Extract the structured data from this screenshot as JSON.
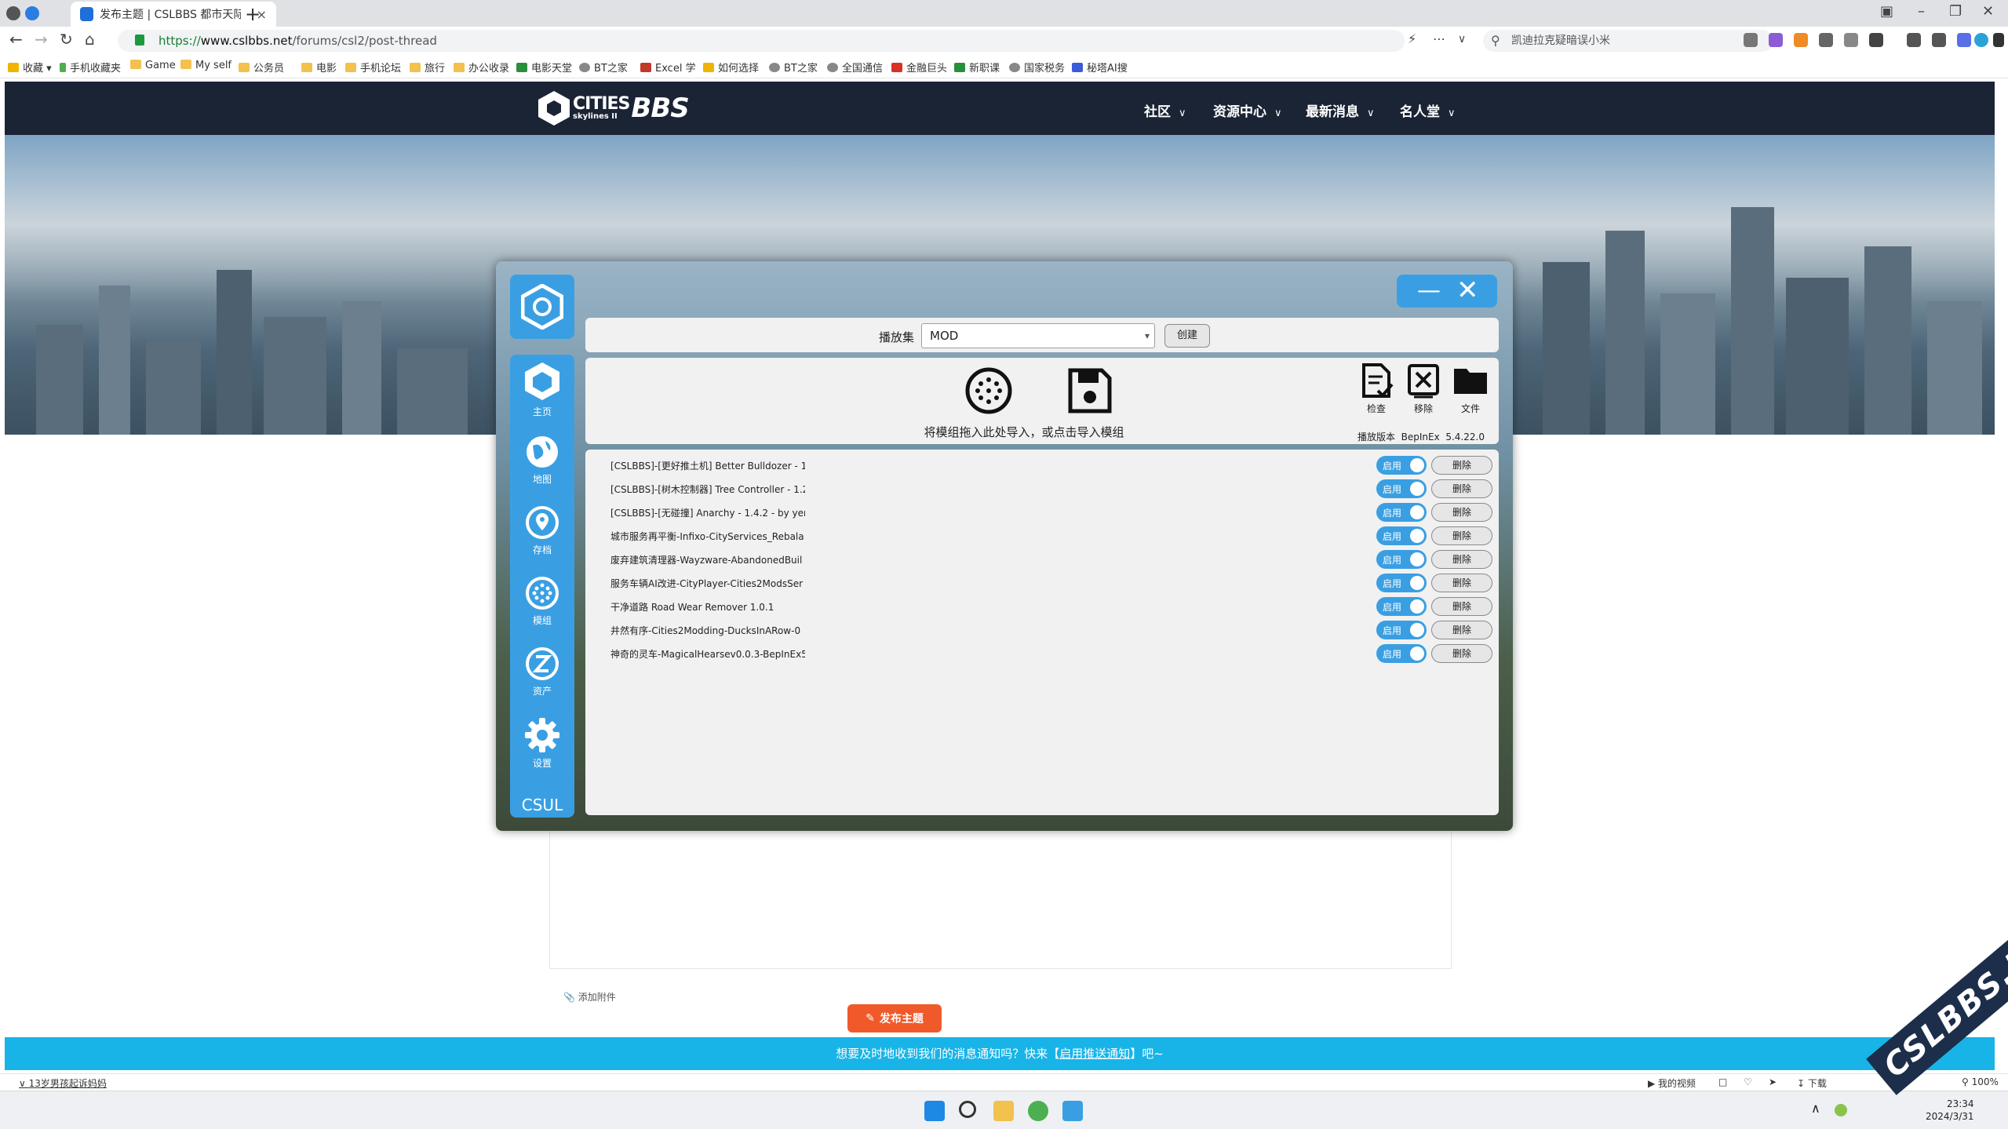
{
  "browser": {
    "active_tab_title": "发布主题 | CSLBBS 都市天际",
    "tab_close": "×",
    "new_tab": "+",
    "url_scheme": "https://",
    "url_host": "www.cslbbs.net",
    "url_path": "/forums/csl2/post-thread",
    "search_placeholder": "凯迪拉克疑暗误小米",
    "bookmarks": [
      "收藏",
      "手机收藏夹",
      "Game",
      "My self",
      "公务员",
      "电影",
      "手机论坛",
      "旅行",
      "办公收录",
      "电影天堂",
      "BT之家",
      "Excel 学",
      "如何选择",
      "BT之家",
      "全国通信",
      "金融巨头",
      "新职课",
      "国家税务",
      "秘塔AI搜"
    ]
  },
  "site": {
    "logo_line1": "CITIES",
    "logo_line2": "skylines II",
    "logo_bbs": "BBS",
    "nav": [
      "社区",
      "资源中心",
      "最新消息",
      "名人堂"
    ],
    "attach_label": "添加附件",
    "post_button": "发布主题",
    "notify_prefix": "想要及时地收到我们的消息通知吗？快来【",
    "notify_link": "启用推送通知",
    "notify_suffix": "】吧~",
    "watermark": "CSLBBS.NET"
  },
  "app": {
    "sidebar": [
      {
        "label": "主页",
        "icon": "home-hexagon-icon"
      },
      {
        "label": "地图",
        "icon": "globe-icon"
      },
      {
        "label": "存档",
        "icon": "location-pin-icon"
      },
      {
        "label": "模组",
        "icon": "dotted-circle-icon"
      },
      {
        "label": "资产",
        "icon": "z-circle-icon"
      },
      {
        "label": "设置",
        "icon": "gear-icon"
      }
    ],
    "brand": "CSUL",
    "playset_label": "播放集",
    "playset_value": "MOD",
    "create_button": "创建",
    "import_hint": "将模组拖入此处导入，或点击导入模组",
    "tools": [
      {
        "label": "检查",
        "icon": "check-file-icon"
      },
      {
        "label": "移除",
        "icon": "remove-box-icon"
      },
      {
        "label": "文件",
        "icon": "folder-icon"
      }
    ],
    "bepinex_label": "播放版本",
    "bepinex_name": "BepInEx",
    "bepinex_version": "5.4.22.0",
    "enable_label": "启用",
    "delete_label": "删除",
    "mods": [
      "[CSLBBS]-[更好推土机] Better Bulldozer - 1",
      "[CSLBBS]-[树木控制器] Tree Controller - 1.2",
      "[CSLBBS]-[无碰撞] Anarchy - 1.4.2 - by yen",
      "城市服务再平衡-Infixo-CityServices_Rebala",
      "废弃建筑清理器-Wayzware-AbandonedBuil",
      "服务车辆AI改进-CityPlayer-Cities2ModsSer",
      "干净道路 Road Wear Remover 1.0.1",
      "井然有序-Cities2Modding-DucksInARow-0",
      "神奇的灵车-MagicalHearsev0.0.3-BepInEx5"
    ]
  },
  "status": {
    "left_text": "13岁男孩起诉妈妈",
    "video": "我的视频",
    "download": "下载",
    "zoom": "100%"
  },
  "clock": {
    "time": "23:34",
    "date": "2024/3/31"
  },
  "colors": {
    "app_accent": "#3a9fe2",
    "site_header": "#1b2435",
    "notify_bar": "#18b4e8",
    "post_button": "#f05a2a"
  }
}
